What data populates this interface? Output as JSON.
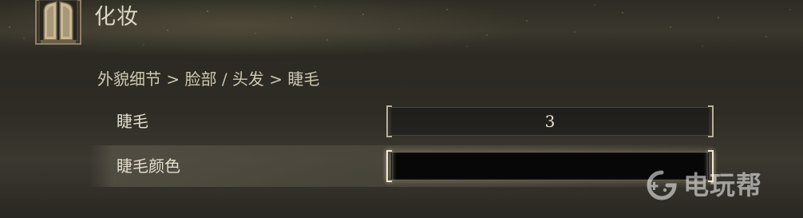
{
  "header": {
    "title": "化妆",
    "icon": "shrine-doors-icon"
  },
  "breadcrumb": {
    "text": "外貌细节 > 脸部 / 头发 > 睫毛"
  },
  "settings": [
    {
      "label": "睫毛",
      "value": "3",
      "state": "normal"
    },
    {
      "label": "睫毛颜色",
      "value": "",
      "state": "selected",
      "swatch_color": "#070707"
    }
  ],
  "watermark": {
    "text": "电玩帮",
    "icon": "gamepad-logo-icon"
  },
  "colors": {
    "text": "#ddd6c4",
    "bracket": "#b9b09a",
    "highlight_bracket": "#efe7cf"
  }
}
